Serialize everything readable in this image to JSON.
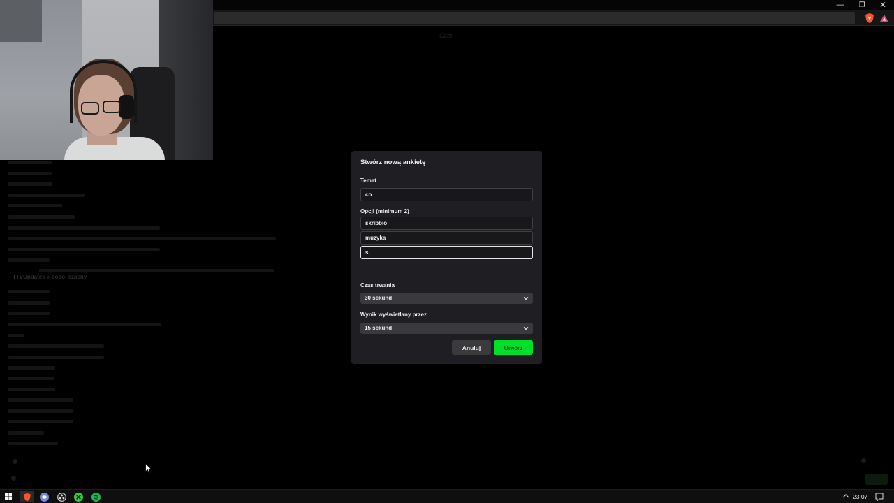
{
  "browser": {
    "window_controls": {
      "minimize": "—",
      "maximize": "❐",
      "close": "✕"
    },
    "icons": [
      "brave-shield-icon",
      "brave-rewards-icon"
    ],
    "accent": "#fb542b"
  },
  "page": {
    "hint": "Czat",
    "chat_highlight": "TTVUpdates » bodo_szachy"
  },
  "poll_modal": {
    "title": "Stwórz nową ankietę",
    "topic_label": "Temat",
    "topic_value": "co",
    "options_label": "Opcji (minimum 2)",
    "options": [
      "skribbio",
      "muzyka",
      "s"
    ],
    "duration_label": "Czas trwania",
    "duration_value": "30 sekund",
    "result_label": "Wynik wyświetlany przez",
    "result_value": "15 sekund",
    "cancel_label": "Anuluj",
    "create_label": "Utwórz",
    "accent": "#00e02a"
  },
  "taskbar": {
    "apps": [
      "windows-start-icon",
      "brave-browser-icon",
      "discord-icon",
      "obs-icon",
      "xsplit-icon",
      "spotify-icon"
    ],
    "time": "23:07"
  }
}
